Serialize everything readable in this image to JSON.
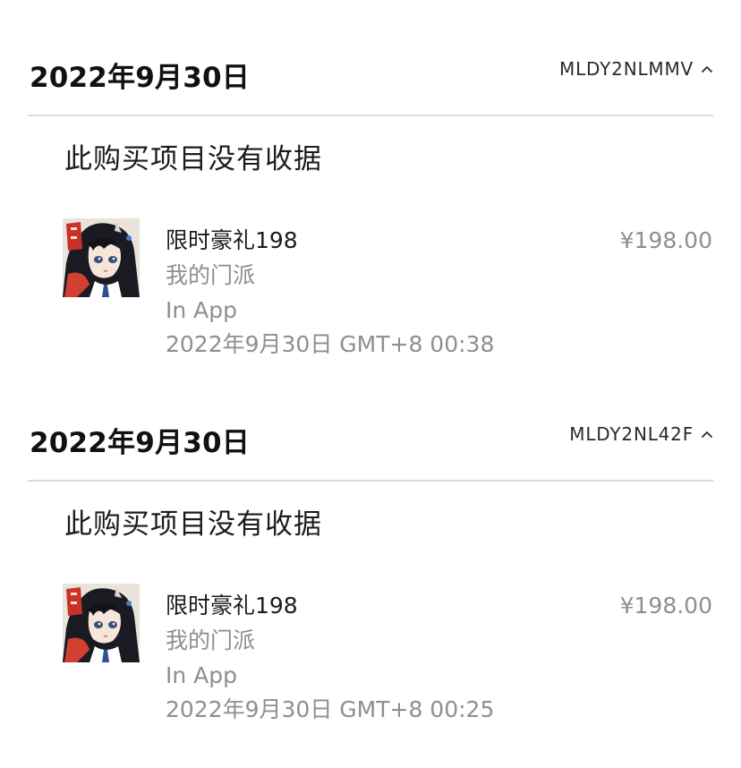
{
  "purchases": [
    {
      "date": "2022年9月30日",
      "order_id": "MLDY2NLMMV",
      "receipt_note": "此购买项目没有收据",
      "item": {
        "title": "限时豪礼198",
        "app_name": "我的门派",
        "type": "In App",
        "datetime": "2022年9月30日 GMT+8 00:38",
        "price": "¥198.00",
        "icon": "game-app-icon"
      }
    },
    {
      "date": "2022年9月30日",
      "order_id": "MLDY2NL42F",
      "receipt_note": "此购买项目没有收据",
      "item": {
        "title": "限时豪礼198",
        "app_name": "我的门派",
        "type": "In App",
        "datetime": "2022年9月30日 GMT+8 00:25",
        "price": "¥198.00",
        "icon": "game-app-icon"
      }
    }
  ],
  "colors": {
    "primary_text": "#1c1c1e",
    "secondary_text": "#8e8e93",
    "divider": "#dcdcdf",
    "background": "#ffffff"
  }
}
